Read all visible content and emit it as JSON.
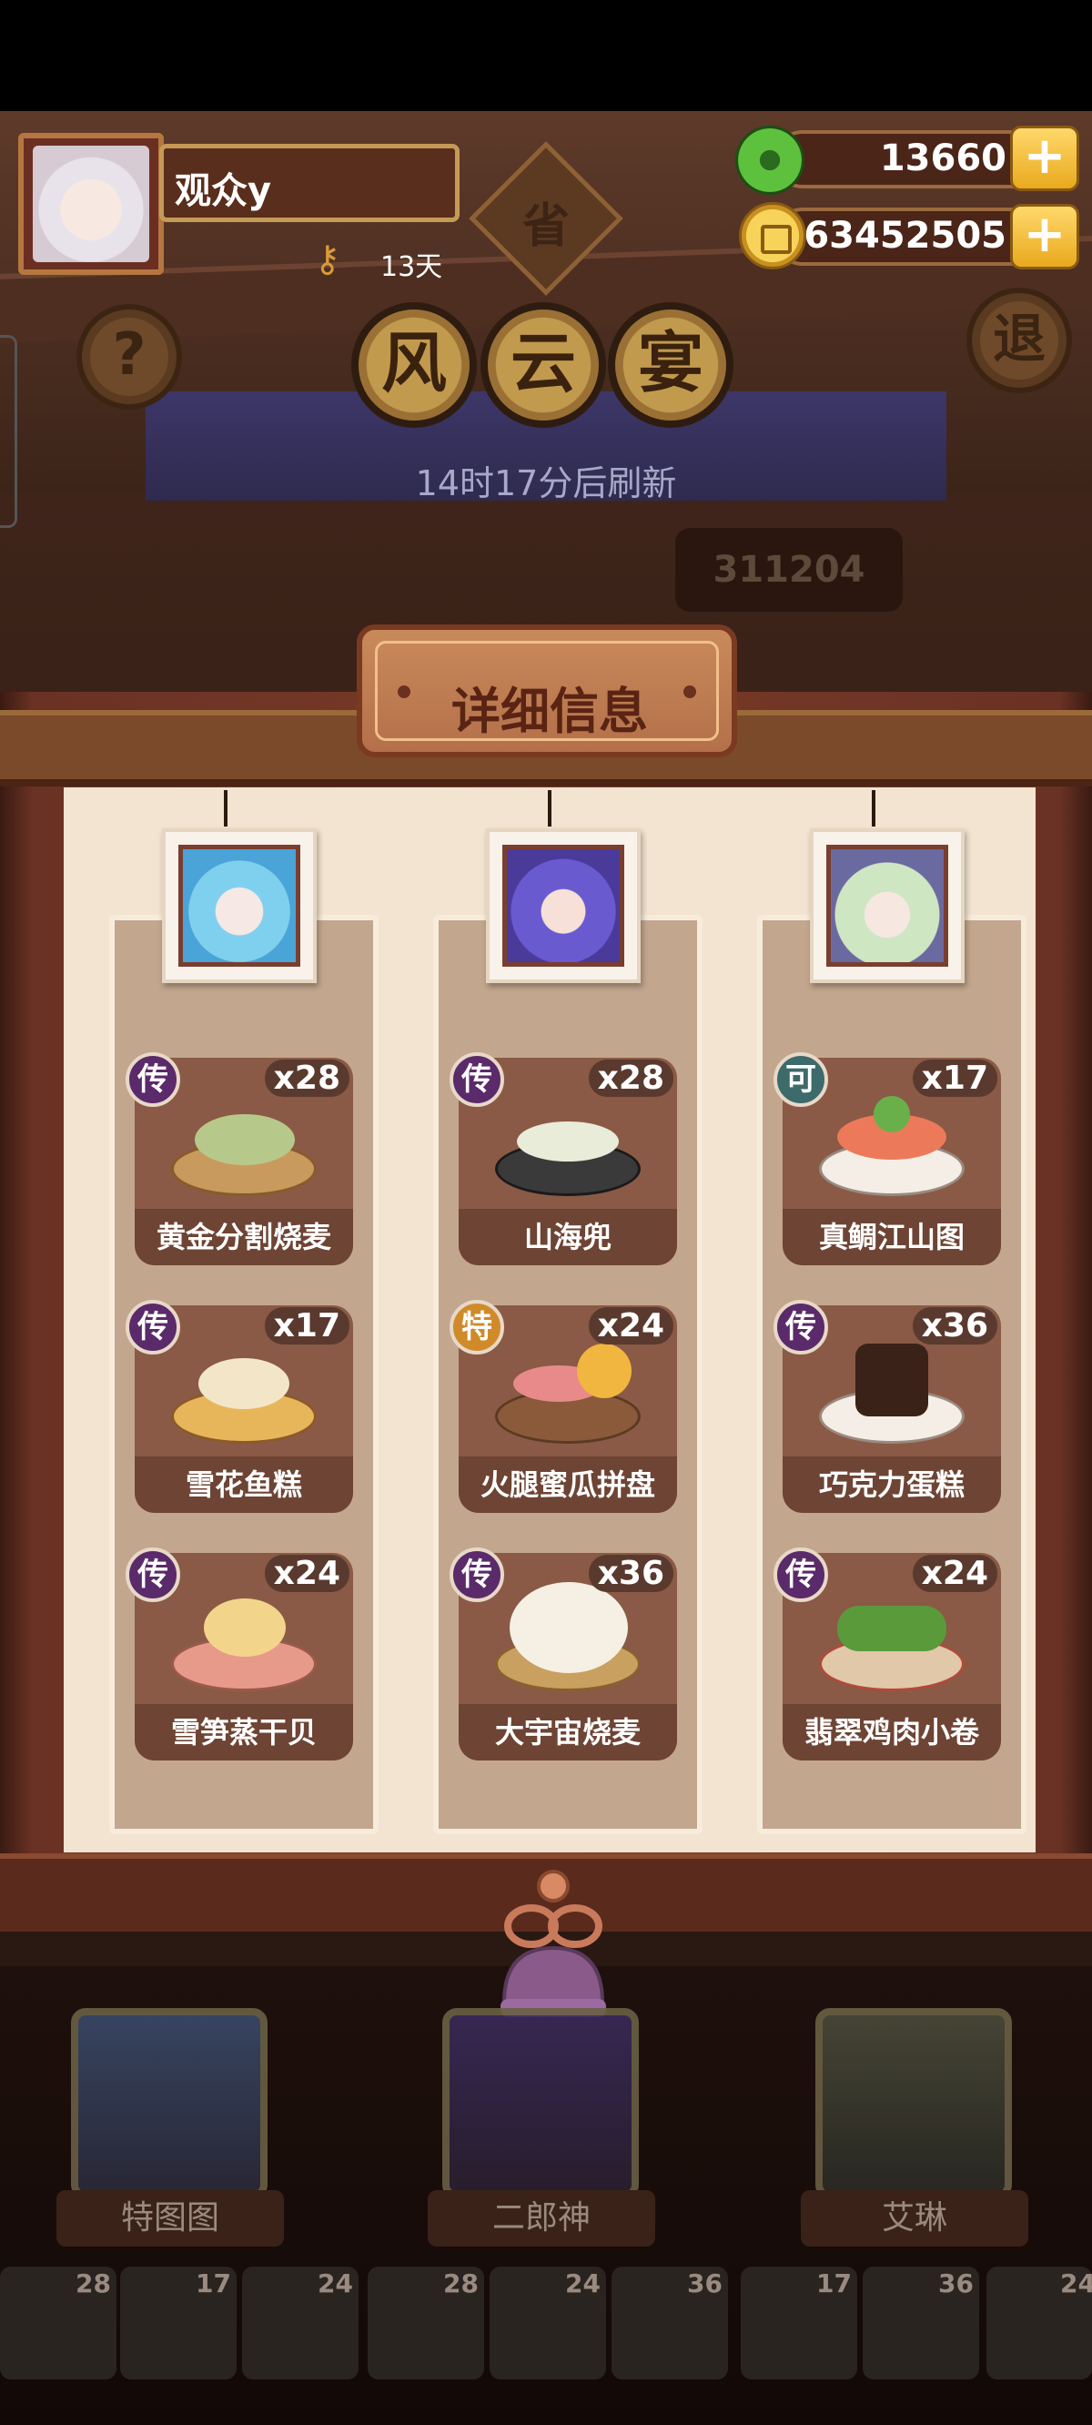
{
  "player": {
    "name": "观众y",
    "days": "13天"
  },
  "province_badge": "省",
  "currency": {
    "jade": "13660",
    "coins": "63452505",
    "plus": "+"
  },
  "buttons": {
    "help": "?",
    "exit": "退"
  },
  "event_title": [
    "风",
    "云",
    "宴"
  ],
  "refresh_text": "14时17分后刷新",
  "score_partial": "311204",
  "panel_title": "详细信息",
  "columns": [
    {
      "character": "特图图",
      "dishes": [
        {
          "name": "黄金分割烧麦",
          "count": "x28",
          "rarity": "传"
        },
        {
          "name": "雪花鱼糕",
          "count": "x17",
          "rarity": "传"
        },
        {
          "name": "雪笋蒸干贝",
          "count": "x24",
          "rarity": "传"
        }
      ]
    },
    {
      "character": "二郎神",
      "dishes": [
        {
          "name": "山海兜",
          "count": "x28",
          "rarity": "传"
        },
        {
          "name": "火腿蜜瓜拼盘",
          "count": "x24",
          "rarity": "特"
        },
        {
          "name": "大宇宙烧麦",
          "count": "x36",
          "rarity": "传"
        }
      ]
    },
    {
      "character": "艾琳",
      "dishes": [
        {
          "name": "真鲷江山图",
          "count": "x17",
          "rarity": "可"
        },
        {
          "name": "巧克力蛋糕",
          "count": "x36",
          "rarity": "传"
        },
        {
          "name": "翡翠鸡肉小卷",
          "count": "x24",
          "rarity": "传"
        }
      ]
    }
  ],
  "bottom_characters": [
    "特图图",
    "二郎神",
    "艾琳"
  ],
  "dish_tray": [
    "28",
    "17",
    "24",
    "28",
    "24",
    "36",
    "17",
    "36",
    "24"
  ],
  "colors": {
    "panel_paper": "#f2e4d0",
    "card": "#8a5a46",
    "rarity_legend": "#5a2a6a",
    "jade": "#5ec13e",
    "coin": "#f7d35a"
  }
}
